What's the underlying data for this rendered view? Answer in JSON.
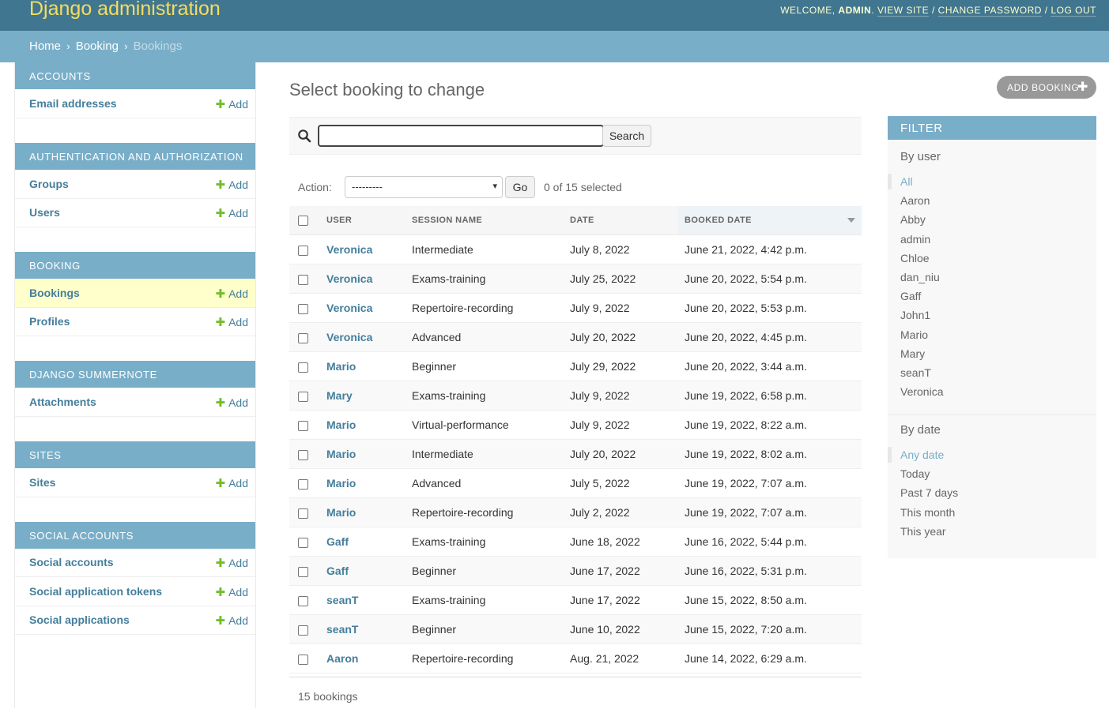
{
  "header": {
    "site_name": "Django administration",
    "welcome": "WELCOME,",
    "username": "ADMIN",
    "view_site": "VIEW SITE",
    "change_password": "CHANGE PASSWORD",
    "log_out": "LOG OUT",
    "sep": "/",
    "dot": "."
  },
  "breadcrumbs": {
    "home": "Home",
    "app": "Booking",
    "current": "Bookings",
    "sep": "›"
  },
  "sidebar": {
    "add_label": "Add",
    "modules": [
      {
        "caption": "ACCOUNTS",
        "models": [
          {
            "name": "Email addresses"
          }
        ]
      },
      {
        "caption": "AUTHENTICATION AND AUTHORIZATION",
        "models": [
          {
            "name": "Groups"
          },
          {
            "name": "Users"
          }
        ]
      },
      {
        "caption": "BOOKING",
        "models": [
          {
            "name": "Bookings"
          },
          {
            "name": "Profiles"
          }
        ]
      },
      {
        "caption": "DJANGO SUMMERNOTE",
        "models": [
          {
            "name": "Attachments"
          }
        ]
      },
      {
        "caption": "SITES",
        "models": [
          {
            "name": "Sites"
          }
        ]
      },
      {
        "caption": "SOCIAL ACCOUNTS",
        "models": [
          {
            "name": "Social accounts"
          },
          {
            "name": "Social application tokens"
          },
          {
            "name": "Social applications"
          }
        ]
      }
    ]
  },
  "main": {
    "title": "Select booking to change",
    "add_button": "ADD BOOKING",
    "search": {
      "value": "",
      "button": "Search"
    },
    "actions": {
      "label": "Action:",
      "selected": "---------",
      "go": "Go",
      "counter": "0 of 15 selected"
    },
    "columns": [
      "USER",
      "SESSION NAME",
      "DATE",
      "BOOKED DATE"
    ],
    "rows": [
      [
        "Veronica",
        "Intermediate",
        "July 8, 2022",
        "June 21, 2022, 4:42 p.m."
      ],
      [
        "Veronica",
        "Exams-training",
        "July 25, 2022",
        "June 20, 2022, 5:54 p.m."
      ],
      [
        "Veronica",
        "Repertoire-recording",
        "July 9, 2022",
        "June 20, 2022, 5:53 p.m."
      ],
      [
        "Veronica",
        "Advanced",
        "July 20, 2022",
        "June 20, 2022, 4:45 p.m."
      ],
      [
        "Mario",
        "Beginner",
        "July 29, 2022",
        "June 20, 2022, 3:44 a.m."
      ],
      [
        "Mary",
        "Exams-training",
        "July 9, 2022",
        "June 19, 2022, 6:58 p.m."
      ],
      [
        "Mario",
        "Virtual-performance",
        "July 9, 2022",
        "June 19, 2022, 8:22 a.m."
      ],
      [
        "Mario",
        "Intermediate",
        "July 20, 2022",
        "June 19, 2022, 8:02 a.m."
      ],
      [
        "Mario",
        "Advanced",
        "July 5, 2022",
        "June 19, 2022, 7:07 a.m."
      ],
      [
        "Mario",
        "Repertoire-recording",
        "July 2, 2022",
        "June 19, 2022, 7:07 a.m."
      ],
      [
        "Gaff",
        "Exams-training",
        "June 18, 2022",
        "June 16, 2022, 5:44 p.m."
      ],
      [
        "Gaff",
        "Beginner",
        "June 17, 2022",
        "June 16, 2022, 5:31 p.m."
      ],
      [
        "seanT",
        "Exams-training",
        "June 17, 2022",
        "June 15, 2022, 8:50 a.m."
      ],
      [
        "seanT",
        "Beginner",
        "June 10, 2022",
        "June 15, 2022, 7:20 a.m."
      ],
      [
        "Aaron",
        "Repertoire-recording",
        "Aug. 21, 2022",
        "June 14, 2022, 6:29 a.m."
      ]
    ],
    "paginator": "15 bookings"
  },
  "filter": {
    "title": "FILTER",
    "by_user": {
      "heading": "By user",
      "items": [
        "All",
        "Aaron",
        "Abby",
        "admin",
        "Chloe",
        "dan_niu",
        "Gaff",
        "John1",
        "Mario",
        "Mary",
        "seanT",
        "Veronica"
      ]
    },
    "by_date": {
      "heading": "By date",
      "items": [
        "Any date",
        "Today",
        "Past 7 days",
        "This month",
        "This year"
      ]
    }
  }
}
